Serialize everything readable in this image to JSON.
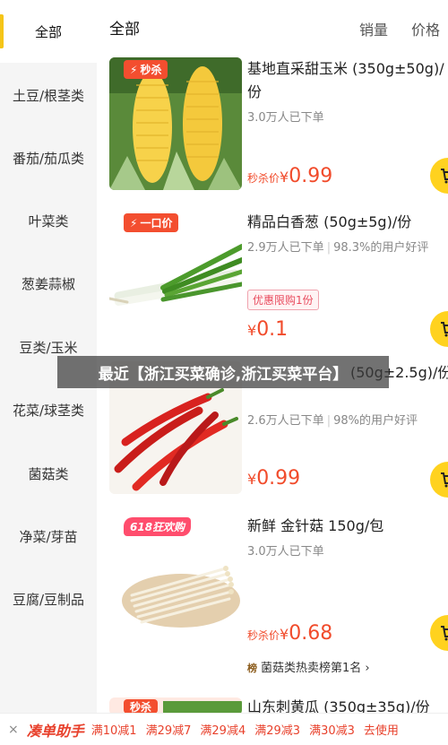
{
  "sidebar": {
    "items": [
      {
        "label": "全部",
        "active": true
      },
      {
        "label": "土豆/根茎类"
      },
      {
        "label": "番茄/茄瓜类"
      },
      {
        "label": "叶菜类"
      },
      {
        "label": "葱姜蒜椒"
      },
      {
        "label": "豆类/玉米"
      },
      {
        "label": "花菜/球茎类"
      },
      {
        "label": "菌菇类"
      },
      {
        "label": "净菜/芽苗"
      },
      {
        "label": "豆腐/豆制品"
      }
    ]
  },
  "header": {
    "title": "全部",
    "sort_sales": "销量",
    "sort_price": "价格"
  },
  "products": [
    {
      "badge": "秒杀",
      "title": "基地直采甜玉米 (350g±50g)/份",
      "sold": "3.0万人已下单",
      "price_prefix": "秒杀价",
      "currency": "¥",
      "price": "0.99"
    },
    {
      "badge": "一口价",
      "title": "精品白香葱 (50g±5g)/份",
      "sold": "2.9万人已下单",
      "rating": "98.3%的用户好评",
      "tag": "优惠限购1份",
      "currency": "¥",
      "price": "0.1"
    },
    {
      "title_partial": "(50g±2.5g)/份",
      "sold": "2.6万人已下单",
      "rating": "98%的用户好评",
      "currency": "¥",
      "price": "0.99"
    },
    {
      "badge": "618狂欢购",
      "title": "新鲜 金针菇 150g/包",
      "sold": "3.0万人已下单",
      "price_prefix": "秒杀价",
      "currency": "¥",
      "price": "0.68",
      "rank_badge": "榜",
      "rank": "菌菇类热卖榜第1名 ›"
    },
    {
      "badge": "秒杀",
      "title_partial": "山东刺黄瓜 (350g±35g)/份"
    }
  ],
  "banner": "最近【浙江买菜确诊,浙江买菜平台】",
  "bottom_bar": {
    "close": "×",
    "brand": "凑单助手",
    "offers": [
      "满10减1",
      "满29减7",
      "满29减4",
      "满29减3",
      "满30减3"
    ],
    "action": "去使用"
  },
  "colors": {
    "accent_yellow": "#ffd21f",
    "price_red": "#f14b2b",
    "badge_red": "#f34e2f"
  }
}
